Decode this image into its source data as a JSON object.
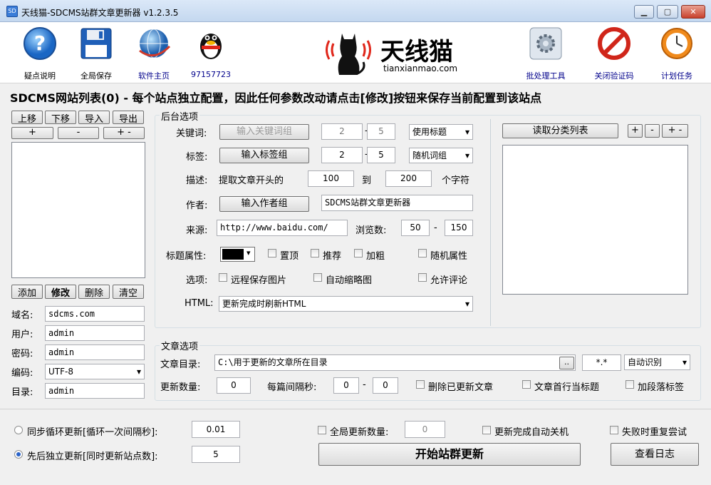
{
  "window": {
    "title": "天线猫-SDCMS站群文章更新器 v1.2.3.5",
    "icon_text": "SD"
  },
  "toolbar": {
    "help": "疑点说明",
    "save_all": "全局保存",
    "home": "软件主页",
    "qq": "97157723",
    "batch": "批处理工具",
    "close_captcha": "关闭验证码",
    "schedule": "计划任务",
    "logo_name": "天线猫",
    "logo_url": "tianxianmao.com"
  },
  "heading": "SDCMS网站列表(0) - 每个站点独立配置，因此任何参数改动请点击[修改]按钮来保存当前配置到该站点",
  "site_list": {
    "up": "上移",
    "down": "下移",
    "import": "导入",
    "export": "导出",
    "plus": "+",
    "minus": "-",
    "plusminus": "+ -",
    "add": "添加",
    "modify": "修改",
    "delete": "删除",
    "clear": "清空"
  },
  "site_fields": [
    {
      "label": "域名:",
      "value": "sdcms.com"
    },
    {
      "label": "用户:",
      "value": "admin"
    },
    {
      "label": "密码:",
      "value": "admin"
    },
    {
      "label": "编码:",
      "value": "UTF-8"
    },
    {
      "label": "目录:",
      "value": "admin"
    }
  ],
  "backend": {
    "title": "后台选项",
    "keyword_label": "关键词:",
    "keyword_btn": "输入关键词组",
    "keyword_min": "2",
    "keyword_max": "5",
    "keyword_mode": "使用标题",
    "tag_label": "标签:",
    "tag_btn": "输入标签组",
    "tag_min": "2",
    "tag_max": "5",
    "tag_mode": "随机词组",
    "desc_label": "描述:",
    "desc_text": "提取文章开头的",
    "desc_min": "100",
    "desc_to": "到",
    "desc_max": "200",
    "desc_unit": "个字符",
    "author_label": "作者:",
    "author_btn": "输入作者组",
    "author_value": "SDCMS站群文章更新器",
    "source_label": "来源:",
    "source_value": "http://www.baidu.com/",
    "views_label": "浏览数:",
    "views_min": "50",
    "views_max": "150",
    "title_attr_label": "标题属性:",
    "top": "置顶",
    "recommend": "推荐",
    "bold": "加粗",
    "random_attr": "随机属性",
    "options_label": "选项:",
    "remote_img": "远程保存图片",
    "auto_thumb": "自动缩略图",
    "allow_comment": "允许评论",
    "html_label": "HTML:",
    "html_mode": "更新完成时刷新HTML",
    "dash": "-"
  },
  "category": {
    "read_btn": "读取分类列表",
    "plus": "+",
    "minus": "-",
    "plusminus": "+ -"
  },
  "article": {
    "title": "文章选项",
    "dir_label": "文章目录:",
    "dir_value": "C:\\用于更新的文章所在目录",
    "browse": "..",
    "ext": "*.*",
    "encoding": "自动识别",
    "count_label": "更新数量:",
    "count_value": "0",
    "interval_label": "每篇间隔秒:",
    "interval_min": "0",
    "interval_max": "0",
    "delete_updated": "删除已更新文章",
    "first_line_title": "文章首行当标题",
    "add_para_tags": "加段落标签"
  },
  "bottom": {
    "sync_label": "同步循环更新[循环一次间隔秒]:",
    "sync_value": "0.01",
    "seq_label": "先后独立更新[同时更新站点数]:",
    "seq_value": "5",
    "global_count_label": "全局更新数量:",
    "global_count_value": "0",
    "auto_shutdown": "更新完成自动关机",
    "retry": "失败时重复尝试",
    "start": "开始站群更新",
    "log": "查看日志"
  }
}
